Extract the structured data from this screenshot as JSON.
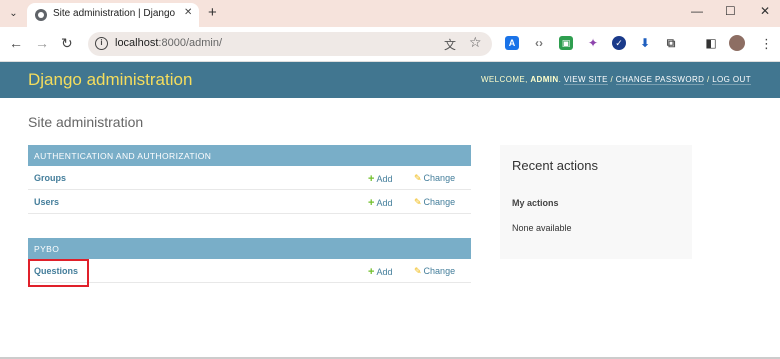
{
  "browser": {
    "tab_title": "Site administration | Django si",
    "tab_close": "✕",
    "new_tab": "+",
    "tab_menu": "⌄",
    "window_minimize": "—",
    "window_maximize": "☐",
    "window_close": "✕",
    "url_host": "localhost",
    "url_path": ":8000/admin/",
    "back": "←",
    "forward": "→",
    "reload": "↻",
    "translate_icon": "文",
    "bookmark_icon": "☆",
    "menu_icon": "⋮",
    "info_icon": "i"
  },
  "extensions": [
    {
      "name": "a-extension-icon",
      "glyph": "A",
      "color": "#1a73e8"
    },
    {
      "name": "code-extension-icon",
      "glyph": "‹›",
      "color": "#777777"
    },
    {
      "name": "green-extension-icon",
      "glyph": "▣",
      "color": "#2e9e4f"
    },
    {
      "name": "purple-extension-icon",
      "glyph": "✦",
      "color": "#8e44ad"
    },
    {
      "name": "check-extension-icon",
      "glyph": "✓",
      "color": "#1a3a8a"
    },
    {
      "name": "download-extension-icon",
      "glyph": "⬇",
      "color": "#1f5fbf"
    },
    {
      "name": "puzzle-extension-icon",
      "glyph": "⧉",
      "color": "#555555"
    },
    {
      "name": "sidepanel-icon",
      "glyph": "◧",
      "color": "#333333"
    }
  ],
  "header": {
    "branding": "Django administration",
    "welcome": "WELCOME,",
    "username": "ADMIN",
    "view_site": "VIEW SITE",
    "change_password": "CHANGE PASSWORD",
    "log_out": "LOG OUT",
    "sep": "/"
  },
  "page_title": "Site administration",
  "modules": [
    {
      "caption": "AUTHENTICATION AND AUTHORIZATION",
      "models": [
        {
          "name": "Groups",
          "add": "Add",
          "change": "Change"
        },
        {
          "name": "Users",
          "add": "Add",
          "change": "Change"
        }
      ]
    },
    {
      "caption": "PYBO",
      "models": [
        {
          "name": "Questions",
          "add": "Add",
          "change": "Change"
        }
      ]
    }
  ],
  "recent_actions": {
    "title": "Recent actions",
    "subtitle": "My actions",
    "empty": "None available"
  },
  "colors": {
    "header_bg": "#417690",
    "branding": "#f5dd5d",
    "caption_bg": "#79aec8",
    "link": "#447e9b",
    "add_plus": "#70bf2b",
    "change_pencil": "#efb80b",
    "highlight": "#e0202a"
  }
}
